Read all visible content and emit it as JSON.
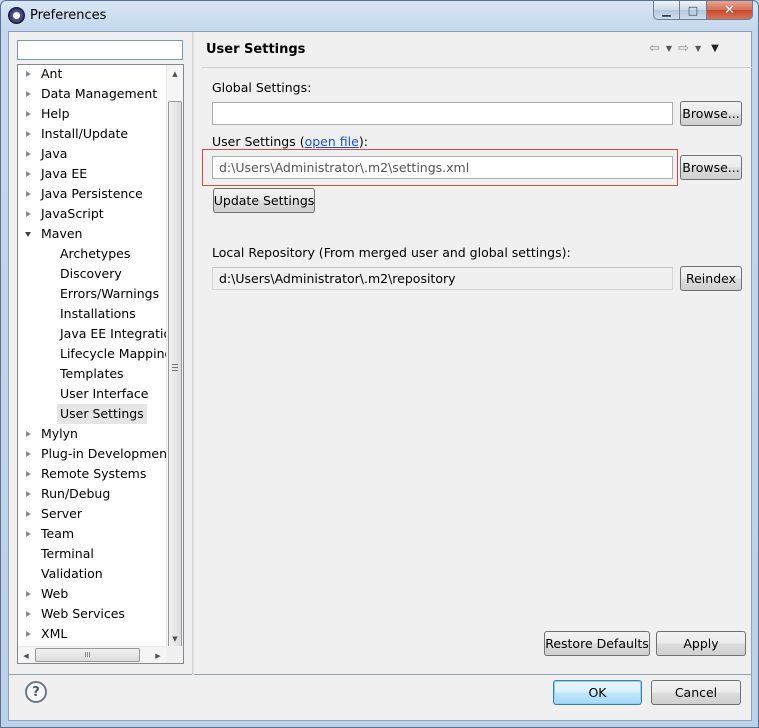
{
  "window": {
    "title": "Preferences",
    "min_icon": "minimize-icon",
    "max_icon": "maximize-icon",
    "close_icon": "close-icon"
  },
  "filter": {
    "value": ""
  },
  "tree": {
    "items": [
      {
        "label": "Ant",
        "expander": "collapsed"
      },
      {
        "label": "Data Management",
        "expander": "collapsed"
      },
      {
        "label": "Help",
        "expander": "collapsed"
      },
      {
        "label": "Install/Update",
        "expander": "collapsed"
      },
      {
        "label": "Java",
        "expander": "collapsed"
      },
      {
        "label": "Java EE",
        "expander": "collapsed"
      },
      {
        "label": "Java Persistence",
        "expander": "collapsed"
      },
      {
        "label": "JavaScript",
        "expander": "collapsed"
      },
      {
        "label": "Maven",
        "expander": "expanded"
      },
      {
        "label": "Archetypes",
        "child": true
      },
      {
        "label": "Discovery",
        "child": true
      },
      {
        "label": "Errors/Warnings",
        "child": true
      },
      {
        "label": "Installations",
        "child": true
      },
      {
        "label": "Java EE Integration",
        "child": true
      },
      {
        "label": "Lifecycle Mappings",
        "child": true
      },
      {
        "label": "Templates",
        "child": true
      },
      {
        "label": "User Interface",
        "child": true
      },
      {
        "label": "User Settings",
        "child": true,
        "selected": true
      },
      {
        "label": "Mylyn",
        "expander": "collapsed"
      },
      {
        "label": "Plug-in Development",
        "expander": "collapsed"
      },
      {
        "label": "Remote Systems",
        "expander": "collapsed"
      },
      {
        "label": "Run/Debug",
        "expander": "collapsed"
      },
      {
        "label": "Server",
        "expander": "collapsed"
      },
      {
        "label": "Team",
        "expander": "collapsed"
      },
      {
        "label": "Terminal",
        "expander": "none"
      },
      {
        "label": "Validation",
        "expander": "none"
      },
      {
        "label": "Web",
        "expander": "collapsed"
      },
      {
        "label": "Web Services",
        "expander": "collapsed"
      },
      {
        "label": "XML",
        "expander": "collapsed"
      }
    ],
    "scroll_grip": "≡",
    "hscroll_grip": "III"
  },
  "page": {
    "title": "User Settings",
    "nav_back": "⇦",
    "nav_forward": "⇨",
    "global_settings_label": "Global Settings:",
    "global_settings_value": "",
    "browse_label": "Browse...",
    "user_settings_label_prefix": "User Settings (",
    "user_settings_link": "open file",
    "user_settings_label_suffix": "):",
    "user_settings_value": "d:\\Users\\Administrator\\.m2\\settings.xml",
    "update_settings": "Update Settings",
    "local_repo_label": "Local Repository (From merged user and global settings):",
    "local_repo_value": "d:\\Users\\Administrator\\.m2\\repository",
    "reindex": "Reindex",
    "restore_defaults": "Restore Defaults",
    "apply": "Apply"
  },
  "footer": {
    "help": "?",
    "ok": "OK",
    "cancel": "Cancel"
  }
}
